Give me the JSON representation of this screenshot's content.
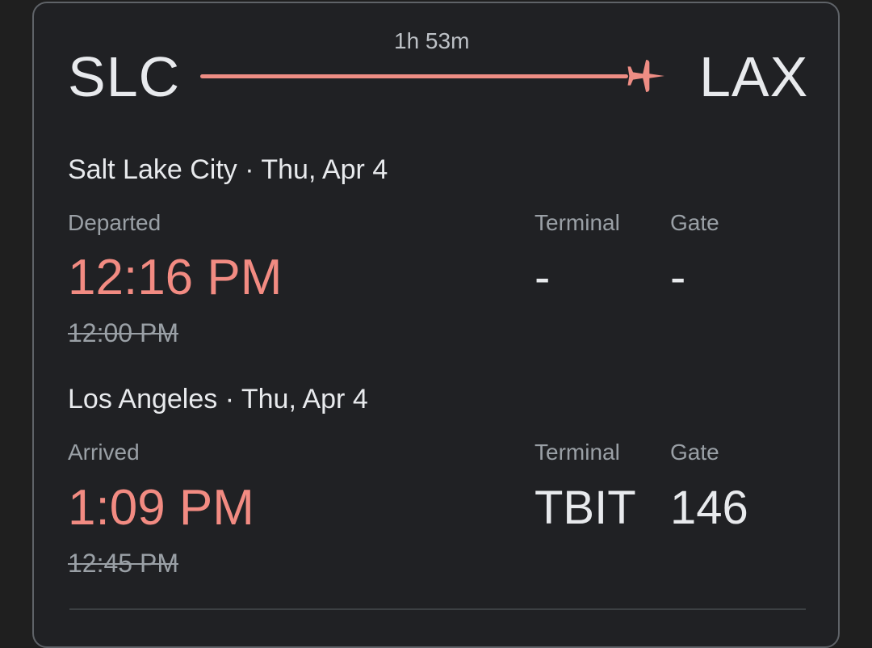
{
  "route": {
    "origin_code": "SLC",
    "destination_code": "LAX",
    "duration": "1h 53m",
    "accent_color": "#f28b82"
  },
  "departure": {
    "city_date": "Salt Lake City · Thu, Apr 4",
    "status_label": "Departed",
    "actual_time": "12:16 PM",
    "scheduled_time": "12:00 PM",
    "terminal_label": "Terminal",
    "terminal_value": "-",
    "gate_label": "Gate",
    "gate_value": "-"
  },
  "arrival": {
    "city_date": "Los Angeles · Thu, Apr 4",
    "status_label": "Arrived",
    "actual_time": "1:09 PM",
    "scheduled_time": "12:45 PM",
    "terminal_label": "Terminal",
    "terminal_value": "TBIT",
    "gate_label": "Gate",
    "gate_value": "146"
  },
  "icons": {
    "route_icon": "airplane-icon"
  }
}
